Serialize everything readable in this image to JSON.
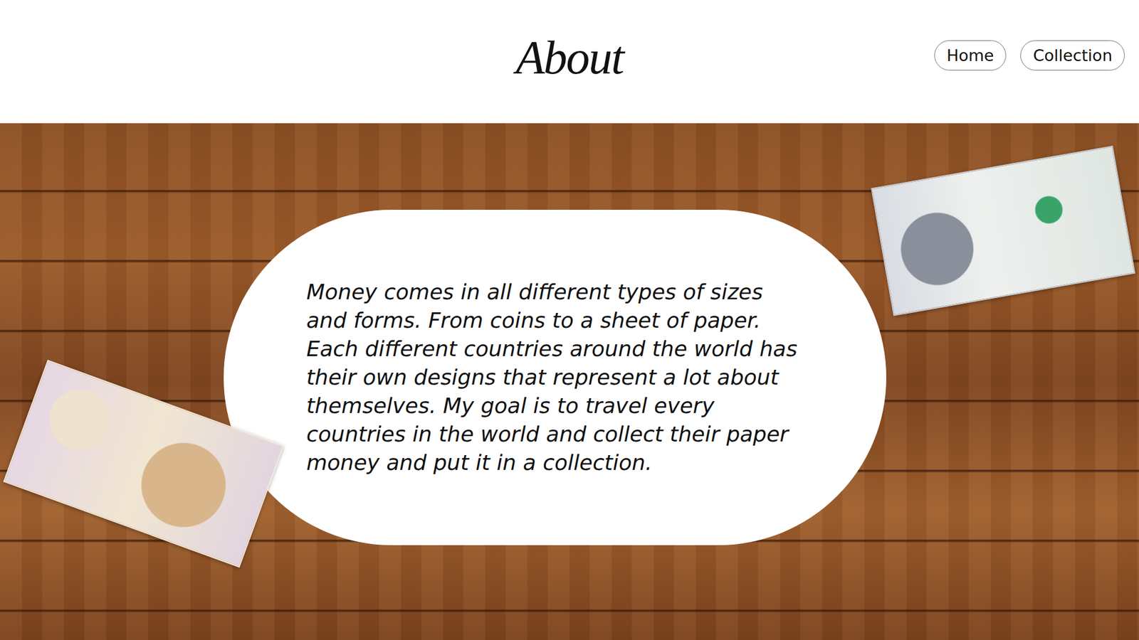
{
  "header": {
    "title": "About"
  },
  "nav": [
    {
      "label": "Home"
    },
    {
      "label": "Collection"
    }
  ],
  "about": {
    "text": "Money comes in all different types of sizes and forms. From coins to a sheet of paper. Each different countries around the world has their own designs that represent a lot about themselves. My goal is to travel every countries in the world and collect their paper money and put it in a collection."
  }
}
